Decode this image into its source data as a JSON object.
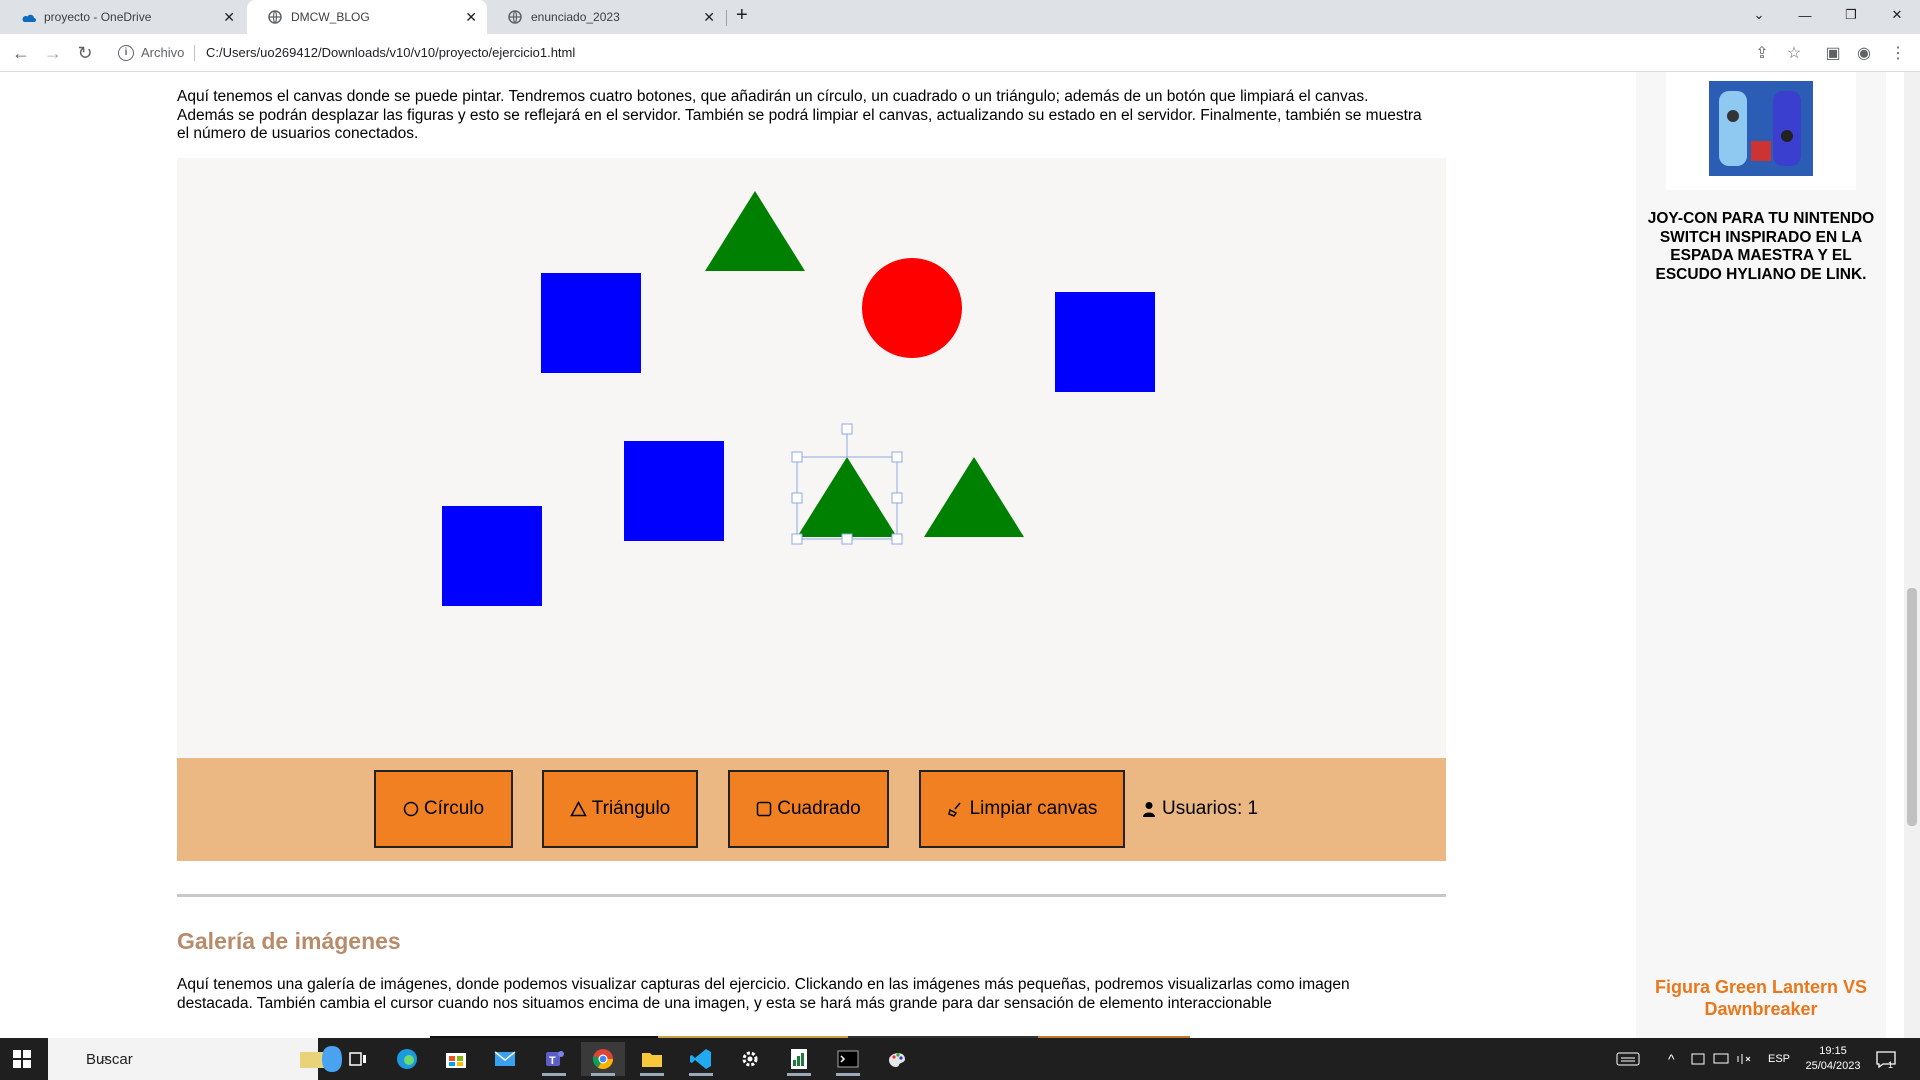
{
  "browser": {
    "tabs": [
      {
        "title": "proyecto - OneDrive",
        "active": false,
        "icon": "onedrive-icon"
      },
      {
        "title": "DMCW_BLOG",
        "active": true,
        "icon": "globe-icon"
      },
      {
        "title": "enunciado_2023",
        "active": false,
        "icon": "globe-icon"
      }
    ],
    "address": {
      "scheme_label": "Archivo",
      "url": "C:/Users/uo269412/Downloads/v10/v10/proyecto/ejercicio1.html"
    }
  },
  "page": {
    "intro_text": "Aquí tenemos el canvas donde se puede pintar. Tendremos cuatro botones, que añadirán un círculo, un cuadrado o un triángulo; además de un botón que limpiará el canvas. Además se podrán desplazar las figuras y esto se reflejará en el servidor. También se podrá limpiar el canvas, actualizando su estado en el servidor. Finalmente, también se muestra el número de usuarios conectados.",
    "canvas": {
      "shape_colors": {
        "triangle": "#008000",
        "square": "#0000ff",
        "circle": "#ff0000"
      }
    },
    "controls": {
      "circle_label": "Círculo",
      "triangle_label": "Triángulo",
      "square_label": "Cuadrado",
      "clear_label": "Limpiar canvas",
      "users_label": "Usuarios: 1"
    },
    "gallery": {
      "title": "Galería de imágenes",
      "text": "Aquí tenemos una galería de imágenes, donde podemos visualizar capturas del ejercicio. Clickando en las imágenes más pequeñas, podremos visualizarlas como imagen destacada. También cambia el cursor cuando nos situamos encima de una imagen, y esta se hará más grande para dar sensación de elemento interaccionable"
    }
  },
  "sidebar": {
    "product1_text": "JOY-CON PARA TU NINTENDO SWITCH INSPIRADO EN LA ESPADA MAESTRA Y EL ESCUDO HYLIANO DE LINK.",
    "product2_title": "Figura Green Lantern VS Dawnbreaker"
  },
  "taskbar": {
    "search_placeholder": "Buscar",
    "lang": "ESP",
    "time": "19:15",
    "date": "25/04/2023",
    "notification_count": "1"
  },
  "colors": {
    "accent_orange": "#f08021",
    "controls_bg": "#ebb783",
    "gallery_title": "#b88c6b",
    "product_title": "#e9781c"
  }
}
